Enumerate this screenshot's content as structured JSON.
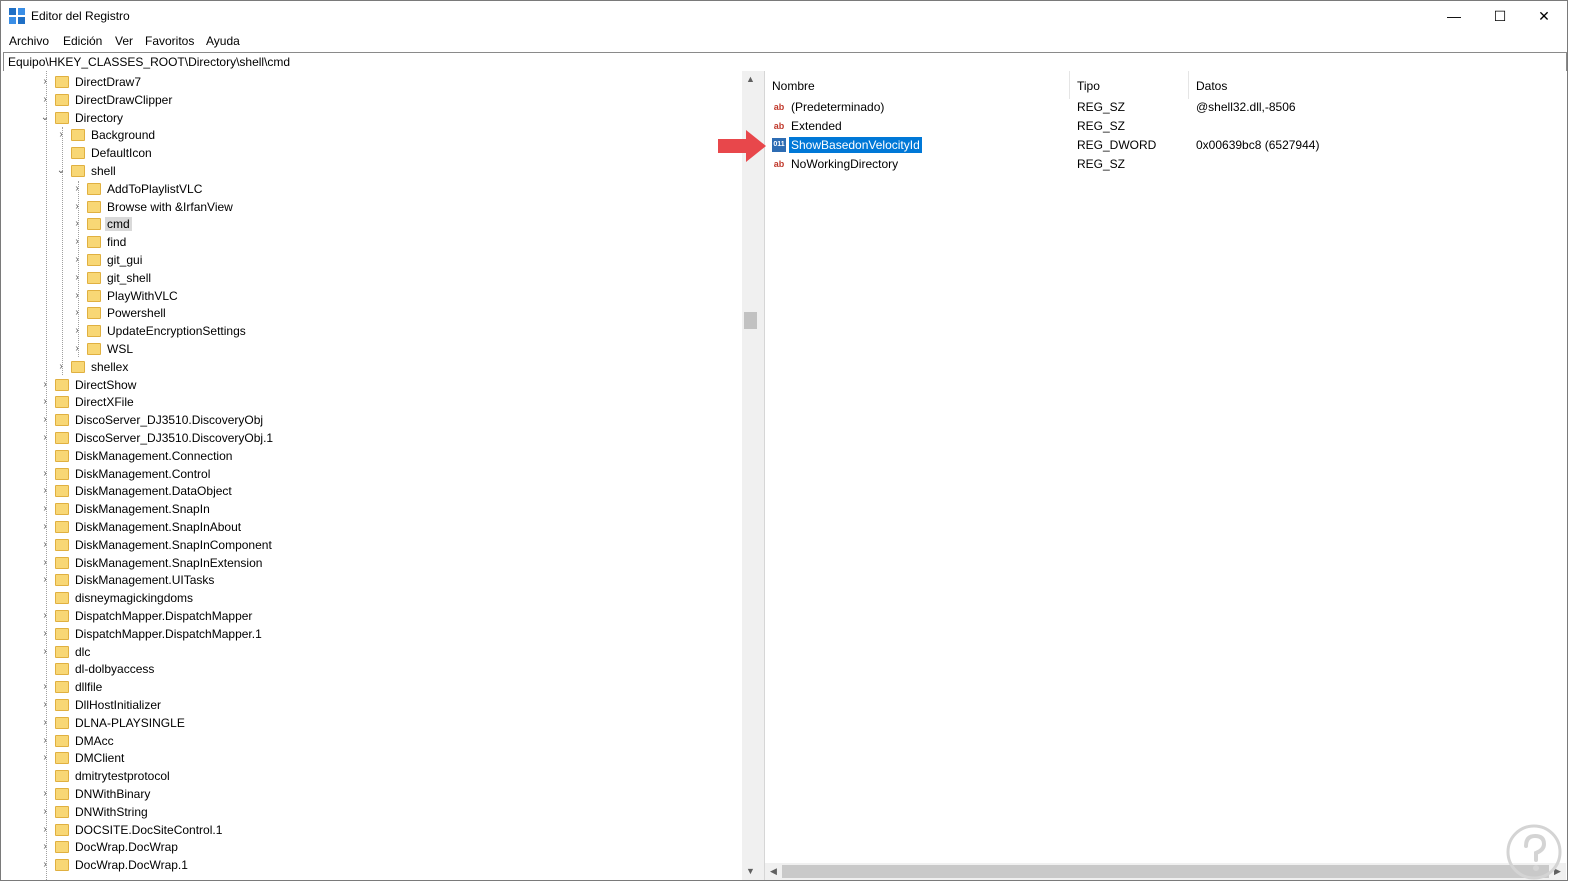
{
  "window": {
    "title": "Editor del Registro",
    "controls": {
      "minimize": "—",
      "maximize": "☐",
      "close": "✕"
    }
  },
  "menu": [
    "Archivo",
    "Edición",
    "Ver",
    "Favoritos",
    "Ayuda"
  ],
  "address": "Equipo\\HKEY_CLASSES_ROOT\\Directory\\shell\\cmd",
  "tree": {
    "items": [
      {
        "label": "DirectDraw7",
        "level": 0,
        "expander": "›"
      },
      {
        "label": "DirectDrawClipper",
        "level": 0,
        "expander": "›"
      },
      {
        "label": "Directory",
        "level": 0,
        "expander": "⌄"
      },
      {
        "label": "Background",
        "level": 1,
        "expander": "›"
      },
      {
        "label": "DefaultIcon",
        "level": 1,
        "expander": ""
      },
      {
        "label": "shell",
        "level": 1,
        "expander": "⌄"
      },
      {
        "label": "AddToPlaylistVLC",
        "level": 2,
        "expander": "›"
      },
      {
        "label": "Browse with &IrfanView",
        "level": 2,
        "expander": "›"
      },
      {
        "label": "cmd",
        "level": 2,
        "expander": "›",
        "selected": true
      },
      {
        "label": "find",
        "level": 2,
        "expander": "›"
      },
      {
        "label": "git_gui",
        "level": 2,
        "expander": "›"
      },
      {
        "label": "git_shell",
        "level": 2,
        "expander": "›"
      },
      {
        "label": "PlayWithVLC",
        "level": 2,
        "expander": "›"
      },
      {
        "label": "Powershell",
        "level": 2,
        "expander": "›"
      },
      {
        "label": "UpdateEncryptionSettings",
        "level": 2,
        "expander": "›"
      },
      {
        "label": "WSL",
        "level": 2,
        "expander": "›"
      },
      {
        "label": "shellex",
        "level": 1,
        "expander": "›"
      },
      {
        "label": "DirectShow",
        "level": 0,
        "expander": "›"
      },
      {
        "label": "DirectXFile",
        "level": 0,
        "expander": "›"
      },
      {
        "label": "DiscoServer_DJ3510.DiscoveryObj",
        "level": 0,
        "expander": "›"
      },
      {
        "label": "DiscoServer_DJ3510.DiscoveryObj.1",
        "level": 0,
        "expander": "›"
      },
      {
        "label": "DiskManagement.Connection",
        "level": 0,
        "expander": ""
      },
      {
        "label": "DiskManagement.Control",
        "level": 0,
        "expander": "›"
      },
      {
        "label": "DiskManagement.DataObject",
        "level": 0,
        "expander": "›"
      },
      {
        "label": "DiskManagement.SnapIn",
        "level": 0,
        "expander": "›"
      },
      {
        "label": "DiskManagement.SnapInAbout",
        "level": 0,
        "expander": "›"
      },
      {
        "label": "DiskManagement.SnapInComponent",
        "level": 0,
        "expander": "›"
      },
      {
        "label": "DiskManagement.SnapInExtension",
        "level": 0,
        "expander": "›"
      },
      {
        "label": "DiskManagement.UITasks",
        "level": 0,
        "expander": "›"
      },
      {
        "label": "disneymagickingdoms",
        "level": 0,
        "expander": ""
      },
      {
        "label": "DispatchMapper.DispatchMapper",
        "level": 0,
        "expander": "›"
      },
      {
        "label": "DispatchMapper.DispatchMapper.1",
        "level": 0,
        "expander": "›"
      },
      {
        "label": "dlc",
        "level": 0,
        "expander": "›"
      },
      {
        "label": "dl-dolbyaccess",
        "level": 0,
        "expander": ""
      },
      {
        "label": "dllfile",
        "level": 0,
        "expander": "›"
      },
      {
        "label": "DllHostInitializer",
        "level": 0,
        "expander": "›"
      },
      {
        "label": "DLNA-PLAYSINGLE",
        "level": 0,
        "expander": "›"
      },
      {
        "label": "DMAcc",
        "level": 0,
        "expander": "›"
      },
      {
        "label": "DMClient",
        "level": 0,
        "expander": "›"
      },
      {
        "label": "dmitrytestprotocol",
        "level": 0,
        "expander": ""
      },
      {
        "label": "DNWithBinary",
        "level": 0,
        "expander": "›"
      },
      {
        "label": "DNWithString",
        "level": 0,
        "expander": "›"
      },
      {
        "label": "DOCSITE.DocSiteControl.1",
        "level": 0,
        "expander": "›"
      },
      {
        "label": "DocWrap.DocWrap",
        "level": 0,
        "expander": "›"
      },
      {
        "label": "DocWrap.DocWrap.1",
        "level": 0,
        "expander": "›"
      }
    ]
  },
  "list": {
    "columns": [
      "Nombre",
      "Tipo",
      "Datos"
    ],
    "rows": [
      {
        "icon": "string-value-icon",
        "name": "(Predeterminado)",
        "type": "REG_SZ",
        "data": "@shell32.dll,-8506"
      },
      {
        "icon": "string-value-icon",
        "name": "Extended",
        "type": "REG_SZ",
        "data": ""
      },
      {
        "icon": "dword-value-icon",
        "name": "ShowBasedonVelocityId",
        "type": "REG_DWORD",
        "data": "0x00639bc8 (6527944)",
        "selected": true
      },
      {
        "icon": "string-value-icon",
        "name": "NoWorkingDirectory",
        "type": "REG_SZ",
        "data": ""
      }
    ]
  },
  "colors": {
    "selection": "#0078d7",
    "folder": "#f8d775",
    "pointer_arrow": "#e8474b"
  }
}
